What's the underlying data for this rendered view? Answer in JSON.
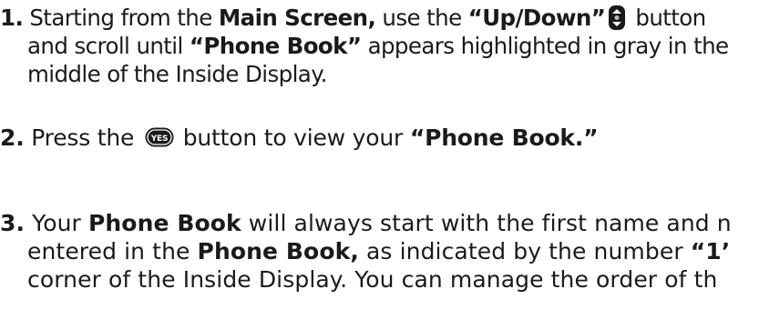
{
  "steps": [
    {
      "number": "1.",
      "t1": "Starting from the ",
      "b1": "Main Screen,",
      "t2": " use the ",
      "b2": "“Up/Down”",
      "t3": " button",
      "t4": "and scroll until ",
      "b3": "“Phone Book”",
      "t5": " appears highlighted in gray in the",
      "t6": "middle of the Inside Display."
    },
    {
      "number": "2.",
      "t1": " Press the ",
      "t2": " button to view your ",
      "b1": "“Phone Book.”"
    },
    {
      "number": "3.",
      "t1": " Your ",
      "b1": "Phone Book",
      "t2": " will always start with the first name and n",
      "t3": "entered in the ",
      "b2": "Phone Book,",
      "t4": " as indicated by the number ",
      "b3": "“1’",
      "t5": "corner of the Inside Display. You can manage the order of th"
    }
  ],
  "icons": {
    "updown": "up-down-button-icon",
    "yes": "yes-button-icon",
    "yes_label": "YES"
  }
}
